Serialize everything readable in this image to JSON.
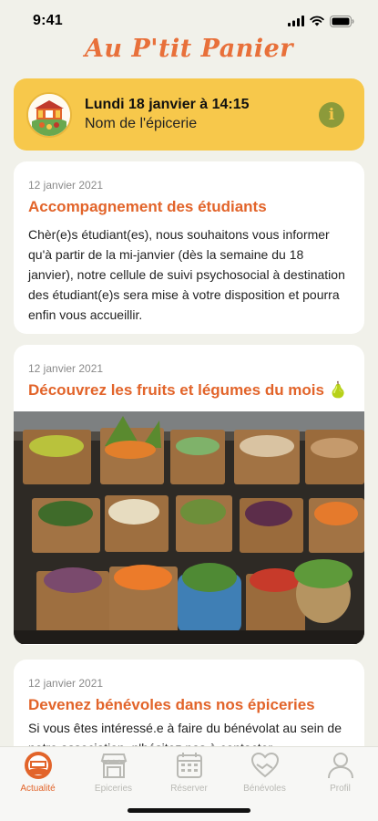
{
  "status_bar": {
    "time": "9:41"
  },
  "header": {
    "app_title": "Au P'tit Panier"
  },
  "booking": {
    "date_line": "Lundi 18 janvier à 14:15",
    "store_name": "Nom de l'épicerie"
  },
  "news": [
    {
      "date": "12 janvier 2021",
      "title": "Accompagnement des étudiants",
      "body": "Chèr(e)s étudiant(es), nous souhaitons vous informer qu'à partir de la mi-janvier (dès la semaine du 18 janvier), notre cellule de suivi psychosocial à destination des étudiant(e)s sera mise à votre disposition et pourra enfin vous accueillir."
    },
    {
      "date": "12 janvier 2021",
      "title": "Découvrez les fruits et légumes du mois 🍐"
    },
    {
      "date": "12 janvier 2021",
      "title": "Devenez bénévoles dans nos épiceries",
      "body": "Si vous êtes intéressé.e à faire du bénévolat au sein de notre association, n'hésitez pas à contacter"
    }
  ],
  "tabs": [
    {
      "label": "Actualité",
      "icon": "news-icon",
      "active": true
    },
    {
      "label": "Epiceries",
      "icon": "store-icon",
      "active": false
    },
    {
      "label": "Réserver",
      "icon": "calendar-icon",
      "active": false
    },
    {
      "label": "Bénévoles",
      "icon": "heart-hands-icon",
      "active": false
    },
    {
      "label": "Profil",
      "icon": "profile-icon",
      "active": false
    }
  ],
  "colors": {
    "accent": "#e2642a",
    "booking_bg": "#f7c84b",
    "background": "#f1f1ea",
    "tab_inactive": "#b9b9b4"
  }
}
